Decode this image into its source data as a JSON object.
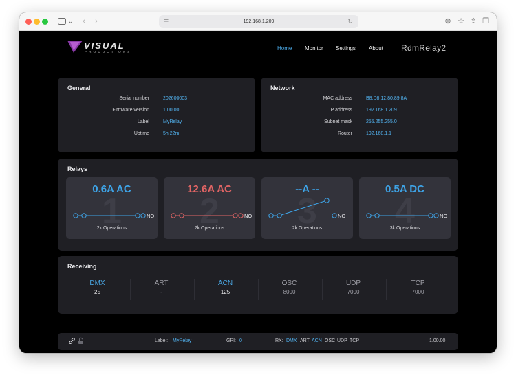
{
  "browser": {
    "address": "192.168.1.209"
  },
  "header": {
    "logo_text": "VISUAL",
    "logo_sub": "PRODUCTIONS",
    "nav": [
      "Home",
      "Monitor",
      "Settings",
      "About"
    ],
    "active_nav": "Home",
    "device_name": "RdmRelay2"
  },
  "general": {
    "title": "General",
    "rows": [
      {
        "label": "Serial number",
        "value": "202600003"
      },
      {
        "label": "Firmware version",
        "value": "1.00.00"
      },
      {
        "label": "Label",
        "value": "MyRelay"
      },
      {
        "label": "Uptime",
        "value": "5h 22m"
      }
    ]
  },
  "network": {
    "title": "Network",
    "rows": [
      {
        "label": "MAC address",
        "value": "B8:D8:12:80:89:8A"
      },
      {
        "label": "IP address",
        "value": "192.168.1.209"
      },
      {
        "label": "Subnet mask",
        "value": "255.255.255.0"
      },
      {
        "label": "Router",
        "value": "192.168.1.1"
      }
    ]
  },
  "relays": {
    "title": "Relays",
    "items": [
      {
        "number": "1",
        "reading": "0.6A AC",
        "color": "#3ea3e6",
        "contact": "NO",
        "state": "closed",
        "operations": "2k Operations"
      },
      {
        "number": "2",
        "reading": "12.6A AC",
        "color": "#e06464",
        "contact": "NO",
        "state": "closed",
        "operations": "2k Operations"
      },
      {
        "number": "3",
        "reading": "--A --",
        "color": "#3ea3e6",
        "contact": "NO",
        "state": "open",
        "operations": "2k Operations"
      },
      {
        "number": "4",
        "reading": "0.5A DC",
        "color": "#3ea3e6",
        "contact": "NO",
        "state": "closed",
        "operations": "3k Operations"
      }
    ]
  },
  "receiving": {
    "title": "Receiving",
    "protocols": [
      {
        "name": "DMX",
        "value": "25",
        "active": true
      },
      {
        "name": "ART",
        "value": "-",
        "active": false
      },
      {
        "name": "ACN",
        "value": "125",
        "active": true
      },
      {
        "name": "OSC",
        "value": "8000",
        "active": false
      },
      {
        "name": "UDP",
        "value": "7000",
        "active": false
      },
      {
        "name": "TCP",
        "value": "7000",
        "active": false
      }
    ]
  },
  "footer": {
    "label_key": "Label:",
    "label_value": "MyRelay",
    "gpi_key": "GPI:",
    "gpi_value": "0",
    "rx_key": "RX:",
    "rx_items": [
      {
        "name": "DMX",
        "active": true
      },
      {
        "name": "ART",
        "active": false
      },
      {
        "name": "ACN",
        "active": true
      },
      {
        "name": "OSC",
        "active": false
      },
      {
        "name": "UDP",
        "active": false
      },
      {
        "name": "TCP",
        "active": false
      }
    ],
    "version": "1.00.00",
    "icons": [
      "link-icon",
      "lock-icon"
    ]
  },
  "colors": {
    "accent": "#4aa8e6",
    "alert": "#e06464",
    "panel": "#1f1f24",
    "card": "#33333b"
  }
}
